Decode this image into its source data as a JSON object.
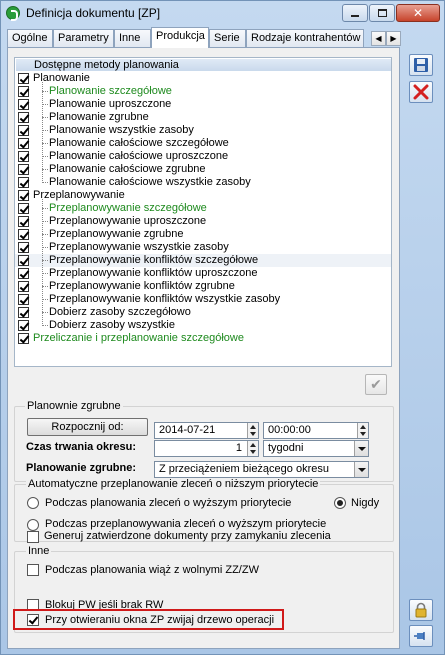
{
  "window": {
    "title": "Definicja dokumentu [ZP]"
  },
  "tabs": [
    "Ogólne",
    "Parametry",
    "Inne",
    "Produkcja",
    "Serie",
    "Rodzaje kontrahentów"
  ],
  "active_tab": "Produkcja",
  "tree": {
    "header": "Dostępne metody planowania",
    "rows": [
      {
        "label": "Planowanie",
        "level": 0,
        "checked": true,
        "color": "#000000"
      },
      {
        "label": "Planowanie szczegółowe",
        "level": 1,
        "checked": true,
        "color": "#1e8a1e"
      },
      {
        "label": "Planowanie uproszczone",
        "level": 1,
        "checked": true,
        "color": "#000000"
      },
      {
        "label": "Planowanie zgrubne",
        "level": 1,
        "checked": true,
        "color": "#000000"
      },
      {
        "label": "Planowanie wszystkie zasoby",
        "level": 1,
        "checked": true,
        "color": "#000000"
      },
      {
        "label": "Planowanie całościowe szczegółowe",
        "level": 1,
        "checked": true,
        "color": "#000000"
      },
      {
        "label": "Planowanie całościowe uproszczone",
        "level": 1,
        "checked": true,
        "color": "#000000"
      },
      {
        "label": "Planowanie całościowe zgrubne",
        "level": 1,
        "checked": true,
        "color": "#000000"
      },
      {
        "label": "Planowanie całościowe wszystkie zasoby",
        "level": 1,
        "checked": true,
        "color": "#000000"
      },
      {
        "label": "Przeplanowywanie",
        "level": 0,
        "checked": true,
        "color": "#000000"
      },
      {
        "label": "Przeplanowywanie szczegółowe",
        "level": 1,
        "checked": true,
        "color": "#1e8a1e"
      },
      {
        "label": "Przeplanowywanie uproszczone",
        "level": 1,
        "checked": true,
        "color": "#000000"
      },
      {
        "label": "Przeplanowywanie zgrubne",
        "level": 1,
        "checked": true,
        "color": "#000000"
      },
      {
        "label": "Przeplanowywanie wszystkie zasoby",
        "level": 1,
        "checked": true,
        "color": "#000000"
      },
      {
        "label": "Przeplanowywanie konfliktów szczegółowe",
        "level": 1,
        "checked": true,
        "color": "#000000"
      },
      {
        "label": "Przeplanowywanie konfliktów uproszczone",
        "level": 1,
        "checked": true,
        "color": "#000000"
      },
      {
        "label": "Przeplanowywanie konfliktów zgrubne",
        "level": 1,
        "checked": true,
        "color": "#000000"
      },
      {
        "label": "Przeplanowywanie konfliktów wszystkie zasoby",
        "level": 1,
        "checked": true,
        "color": "#000000"
      },
      {
        "label": "Dobierz zasoby szczegółowo",
        "level": 1,
        "checked": true,
        "color": "#000000"
      },
      {
        "label": "Dobierz zasoby wszystkie",
        "level": 1,
        "checked": true,
        "color": "#000000"
      },
      {
        "label": "Przeliczanie i przeplanowanie szczegółowe",
        "level": 0,
        "checked": true,
        "color": "#1e8a1e"
      }
    ]
  },
  "planowanie_zgrubne_group": {
    "title": "Planownie zgrubne",
    "start_button": "Rozpocznij od:",
    "date": "2014-07-21",
    "time": "00:00:00",
    "duration_label": "Czas trwania okresu:",
    "duration_value": "1",
    "duration_unit": "tygodni",
    "mode_label": "Planowanie zgrubne:",
    "mode_value": "Z przeciążeniem bieżącego okresu"
  },
  "auto_group": {
    "title": "Automatyczne przeplanowanie zleceń o niższym priorytecie",
    "radio1": "Podczas planowania zleceń o wyższym priorytecie",
    "radio_never": "Nigdy",
    "radio2": "Podczas przeplanowywania zleceń o wyższym priorytecie",
    "selected": "Nigdy"
  },
  "generate_checkbox": {
    "label": "Generuj zatwierdzone dokumenty przy zamykaniu zlecenia",
    "checked": false
  },
  "inne_group": {
    "title": "Inne",
    "link_checkbox": {
      "label": "Podczas planowania wiąż z wolnymi ZZ/ZW",
      "checked": false
    },
    "block_checkbox": {
      "label": "Blokuj PW jeśli brak RW",
      "checked": false
    },
    "collapse_checkbox": {
      "label": "Przy otwieraniu okna ZP zwijaj drzewo operacji",
      "checked": true
    }
  },
  "colors": {
    "accent_highlight": "#d01a1a",
    "green_text": "#1e8a1e"
  }
}
